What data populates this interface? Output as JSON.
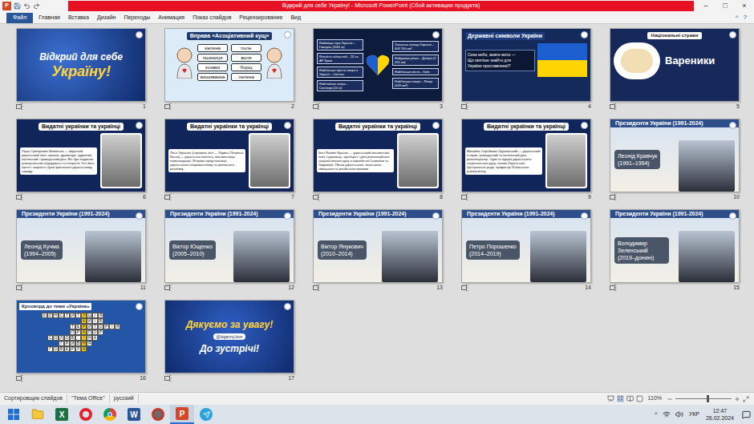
{
  "window": {
    "title": "Відкрий для себе Україну! - Microsoft PowerPoint (Сбой активации продукта)",
    "app_glyph": "P",
    "controls": [
      "–",
      "□",
      "×"
    ]
  },
  "ribbon": {
    "tabs": [
      {
        "label": "Файл",
        "kind": "file",
        "selected": false
      },
      {
        "label": "Главная",
        "kind": "tab",
        "selected": false
      },
      {
        "label": "Вставка",
        "kind": "tab",
        "selected": false
      },
      {
        "label": "Дизайн",
        "kind": "tab",
        "selected": false
      },
      {
        "label": "Переходы",
        "kind": "tab",
        "selected": false
      },
      {
        "label": "Анимация",
        "kind": "tab",
        "selected": false
      },
      {
        "label": "Показ слайдов",
        "kind": "tab",
        "selected": false
      },
      {
        "label": "Рецензирование",
        "kind": "tab",
        "selected": false
      },
      {
        "label": "Вид",
        "kind": "tab",
        "selected": false
      }
    ],
    "right_glyphs": [
      "^",
      "?"
    ]
  },
  "slides": [
    {
      "number": "1",
      "kind": "title",
      "transition": true,
      "lines": [
        "Відкрий для себе",
        "Україну!"
      ]
    },
    {
      "number": "2",
      "kind": "exercise",
      "transition": true,
      "title": "Вправа «Асоціативний кущ»",
      "left_words": [
        "калина",
        "пшениця",
        "козаки",
        "вишиванка"
      ],
      "right_words": [
        "поле",
        "воля",
        "борщ",
        "лелека"
      ]
    },
    {
      "number": "3",
      "kind": "facts",
      "transition": true,
      "left_facts": [
        "Найвища гора України – Говерла (2061 м)",
        "Кількість областей – 24 та АР Крим",
        "Найбільше прісне озеро в Україні – Світязь",
        "Найглибше озеро – Синевир (24 м)"
      ],
      "right_facts": [
        "Загальна площа України – 603 700 км²",
        "Найдовша річка – Дніпро (2 201 км)",
        "Найбільше місто – Київ",
        "Найбільше озеро – Ялпуг (149 км²)"
      ]
    },
    {
      "number": "4",
      "kind": "symbols",
      "transition": true,
      "title": "Державні символи України",
      "lines": [
        "Синє небо, жовте жито —",
        "Що святіше знайти для",
        "України прославленої?"
      ]
    },
    {
      "number": "5",
      "kind": "food",
      "transition": true,
      "title": "Національні страви",
      "dish": "Вареники"
    },
    {
      "number": "6",
      "kind": "person",
      "transition": true,
      "title": "Видатні українки та українці",
      "bio": "Тарас Григорович Шевченко — видатний український поет, прозаїк, драматург, художник, політичний і громадський діяч. Він був людиною універсальних обдарувань та інтересів. Усе його життя і творчість були присвячені українському народу."
    },
    {
      "number": "7",
      "kind": "person",
      "transition": true,
      "title": "Видатні українки та українці",
      "bio": "Леся Українка (справжнє ім'я — Лариса Петрівна Косач) — українська поетеса, письменниця, перекладачка. Яскрава представниця українського неоромантизму та критичного реалізму."
    },
    {
      "number": "8",
      "kind": "person",
      "transition": true,
      "title": "Видатні українки та українці",
      "bio": "Іван Якович Франко — український письменник, поет, науковець, публіцист і діяч революційного соціалістичного руху в королівстві Галичини та Лодомерії. Писав українською, польською, німецькою та російською мовами."
    },
    {
      "number": "9",
      "kind": "person",
      "transition": true,
      "title": "Видатні українки та українці",
      "bio": "Михайло Сергійович Грушевський — український історик, громадський та політичний діяч, революціонер. Один із лідерів українського національного руху, голова Української Центральної ради, професор Львівського університету."
    },
    {
      "number": "10",
      "kind": "president",
      "transition": true,
      "title": "Президенти України (1991-2024)",
      "name": "Леонід Кравчук",
      "years": "(1991–1994)"
    },
    {
      "number": "11",
      "kind": "president",
      "transition": true,
      "title": "Президенти України (1991-2024)",
      "name": "Леонід Кучма",
      "years": "(1994–2005)"
    },
    {
      "number": "12",
      "kind": "president",
      "transition": true,
      "title": "Президенти України (1991-2024)",
      "name": "Віктор Ющенко",
      "years": "(2005–2010)"
    },
    {
      "number": "13",
      "kind": "president",
      "transition": true,
      "title": "Президенти України (1991-2024)",
      "name": "Віктор Янукович",
      "years": "(2010–2014)"
    },
    {
      "number": "14",
      "kind": "president",
      "transition": true,
      "title": "Президенти України (1991-2024)",
      "name": "Петро Порошенко",
      "years": "(2014–2019)"
    },
    {
      "number": "15",
      "kind": "president",
      "transition": true,
      "title": "Президенти України (1991-2024)",
      "name": "Володимир Зеленський",
      "years": "(2019–донині)"
    },
    {
      "number": "16",
      "kind": "crossword",
      "transition": true,
      "title": "Кросворд до теми «Україна»",
      "key_column": 7,
      "rows": [
        {
          "word": "КОНСТИТУЦІЯ",
          "offset": 0
        },
        {
          "word": "КИЇВ",
          "offset": 7
        },
        {
          "word": "ТЕРИТОРІЯ",
          "offset": 5
        },
        {
          "word": "ПРАПОР",
          "offset": 5
        },
        {
          "word": "СОЛОВ'ЇНА",
          "offset": 1
        },
        {
          "word": "ГРИВНЯ",
          "offset": 3
        },
        {
          "word": "ГОВЕРЛА",
          "offset": 1
        }
      ]
    },
    {
      "number": "17",
      "kind": "end",
      "transition": true,
      "lines": [
        "Дякуємо за увагу!",
        "До зустрічі!"
      ],
      "tag": "@loganny.love"
    }
  ],
  "status_bar": {
    "items": [
      "Сортировщик слайдов",
      "\"Тема Office\"",
      "русский"
    ],
    "zoom": "110%",
    "zoom_level": 0.55
  },
  "taskbar": {
    "apps": [
      {
        "kind": "windows",
        "glyph": "",
        "active": false
      },
      {
        "kind": "explorer",
        "glyph": "",
        "active": false
      },
      {
        "kind": "excel",
        "glyph": "X",
        "active": false
      },
      {
        "kind": "opera",
        "glyph": "",
        "active": false
      },
      {
        "kind": "chrome",
        "glyph": "",
        "active": false
      },
      {
        "kind": "word",
        "glyph": "W",
        "active": false
      },
      {
        "kind": "app",
        "glyph": "",
        "active": false
      },
      {
        "kind": "powerpoint",
        "glyph": "P",
        "active": true
      },
      {
        "kind": "telegram",
        "glyph": "",
        "active": false
      }
    ],
    "tray_glyph": "^",
    "language": "УКР",
    "time": "12:47",
    "date": "26.02.2024"
  }
}
